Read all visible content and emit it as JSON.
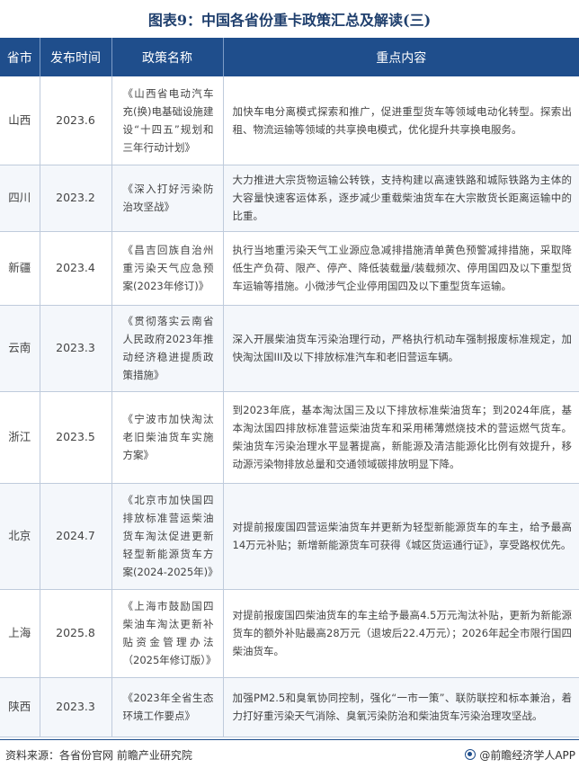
{
  "title": "图表9：中国各省份重卡政策汇总及解读(三)",
  "headers": {
    "province": "省市",
    "date": "发布时间",
    "policy": "政策名称",
    "content": "重点内容"
  },
  "rows": [
    {
      "province": "山西",
      "date": "2023.6",
      "policy": "《山西省电动汽车充(换)电基础设施建设“十四五”规划和三年行动计划》",
      "content": "加快车电分离模式探索和推广，促进重型货车等领域电动化转型。探索出租、物流运输等领域的共享换电模式，优化提升共享换电服务。"
    },
    {
      "province": "四川",
      "date": "2023.2",
      "policy": "《深入打好污染防治攻坚战》",
      "content": "大力推进大宗货物运输公转铁，支持构建以高速铁路和城际铁路为主体的大容量快速客运体系，逐步减少重载柴油货车在大宗散货长距离运输中的比重。"
    },
    {
      "province": "新疆",
      "date": "2023.4",
      "policy": "《昌吉回族自治州重污染天气应急预案(2023年修订)》",
      "content": "执行当地重污染天气工业源应急减排措施清单黄色预警减排措施，采取降低生产负荷、限产、停产、降低装载量/装载频次、停用国四及以下重型货车运输等措施。小微涉气企业停用国四及以下重型货车运输。"
    },
    {
      "province": "云南",
      "date": "2023.3",
      "policy": "《贯彻落实云南省人民政府2023年推动经济稳进提质政策措施》",
      "content": "深入开展柴油货车污染治理行动，严格执行机动车强制报废标准规定，加快淘汰国III及以下排放标准汽车和老旧营运车辆。"
    },
    {
      "province": "浙江",
      "date": "2023.5",
      "policy": "《宁波市加快淘汰老旧柴油货车实施方案》",
      "content": "到2023年底，基本淘汰国三及以下排放标准柴油货车；到2024年底，基本淘汰国四排放标准营运柴油货车和采用稀薄燃烧技术的营运燃气货车。柴油货车污染治理水平显著提高，新能源及清洁能源化比例有效提升，移动源污染物排放总量和交通领域碳排放明显下降。"
    },
    {
      "province": "北京",
      "date": "2024.7",
      "policy": "《北京市加快国四排放标准营运柴油货车淘汰促进更新轻型新能源货车方案(2024-2025年)》",
      "content": "对提前报废国四营运柴油货车并更新为轻型新能源货车的车主，给予最高14万元补贴；新增新能源货车可获得《城区货运通行证》，享受路权优先。"
    },
    {
      "province": "上海",
      "date": "2025.8",
      "policy": "《上海市鼓励国四柴油车淘汰更新补贴资金管理办法（2025年修订版）》",
      "content": "对提前报废国四柴油货车的车主给予最高4.5万元淘汰补贴，更新为新能源货车的额外补贴最高28万元（退坡后22.4万元）；2026年起全市限行国四柴油货车。"
    },
    {
      "province": "陕西",
      "date": "2023.3",
      "policy": "《2023年全省生态环境工作要点》",
      "content": "加强PM2.5和臭氧协同控制，强化“一市一策”、联防联控和标本兼治，着力打好重污染天气消除、臭氧污染防治和柴油货车污染治理攻坚战。"
    }
  ],
  "footer": {
    "source": "资料来源：各省份官网 前瞻产业研究院",
    "brand": "@前瞻经济学人APP"
  },
  "colors": {
    "header_bg": "#1f4e8c",
    "title": "#1f3f6d",
    "row_alt": "#f4f7fb",
    "border": "#bfcbdc"
  }
}
